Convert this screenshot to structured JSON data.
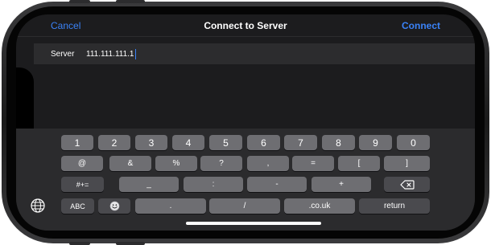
{
  "navbar": {
    "cancel_label": "Cancel",
    "title": "Connect to Server",
    "connect_label": "Connect"
  },
  "form": {
    "server_label": "Server",
    "server_value": "111.111.111.1"
  },
  "keyboard": {
    "row1": [
      "1",
      "2",
      "3",
      "4",
      "5",
      "6",
      "7",
      "8",
      "9",
      "0"
    ],
    "row2": [
      "@",
      "&",
      "%",
      "?",
      ",",
      "=",
      "[",
      "]"
    ],
    "row3": [
      "#+=",
      "_",
      ":",
      "-",
      "+"
    ],
    "row4": [
      "ABC",
      ".",
      "/",
      ".co.uk",
      "return"
    ]
  },
  "icons": {
    "globe": "globe-icon",
    "emoji": "emoji-icon",
    "delete": "delete-backward-icon"
  },
  "colors": {
    "accent": "#3a82f7",
    "screen_bg": "#1c1c1e",
    "key_bg": "#6e6e72",
    "function_key_bg": "#4a4a4e"
  }
}
